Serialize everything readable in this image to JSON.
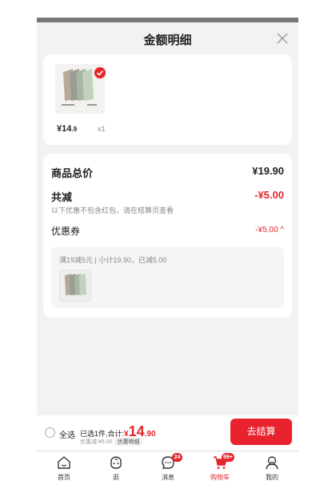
{
  "sheet": {
    "title": "金额明细"
  },
  "product": {
    "currency": "¥",
    "price_int": "14",
    "price_dec": ".9",
    "qty": "x1"
  },
  "summary": {
    "goods_total_label": "商品总价",
    "goods_total_value": "¥19.90",
    "discount_label": "共减",
    "discount_value": "-¥5.00",
    "discount_note": "以下优惠不包含红包，请在结算页查看",
    "coupon_label": "优惠券",
    "coupon_value": "-¥5.00 ^",
    "coupon_desc": "满19减5元 | 小计19.90，已减5.00"
  },
  "bottom": {
    "select_all": "全选",
    "selected_text": "已选1件,合计:",
    "total_currency": "¥",
    "total_int": "14",
    "total_dec": ".90",
    "discount_text": "优惠减:¥5.00",
    "detail_tag": "优惠明细",
    "checkout": "去结算"
  },
  "tabs": [
    {
      "label": "首页",
      "icon": "home-icon"
    },
    {
      "label": "逛",
      "icon": "browse-face-icon"
    },
    {
      "label": "消息",
      "icon": "message-icon",
      "badge": "24"
    },
    {
      "label": "购物车",
      "icon": "cart-icon",
      "badge": "99+",
      "active": true
    },
    {
      "label": "我的",
      "icon": "profile-icon"
    }
  ],
  "colors": {
    "accent": "#e4262d",
    "checkout": "#e8232f",
    "background": "#f2f2f2"
  }
}
